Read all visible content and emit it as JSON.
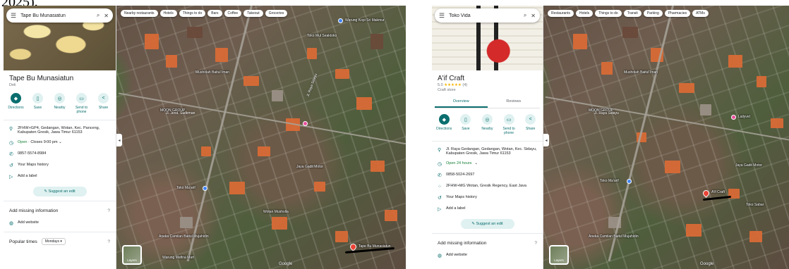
{
  "clip_text": "2025).",
  "left": {
    "search": {
      "query": "Tape Bu Munasiatun"
    },
    "place": {
      "name": "Tape Bu Munasiatun",
      "category": "Deli"
    },
    "actions": [
      {
        "label": "Directions",
        "icon": "directions-icon"
      },
      {
        "label": "Save",
        "icon": "bookmark-icon"
      },
      {
        "label": "Nearby",
        "icon": "nearby-icon"
      },
      {
        "label": "Send to phone",
        "icon": "phone-icon"
      },
      {
        "label": "Share",
        "icon": "share-icon"
      }
    ],
    "info": {
      "address": "2FHW+GP4, Gedangan, Wotan, Kec. Panceng, Kabupaten Gresik, Jawa Timur 61153",
      "hours_status": "Open",
      "hours_detail": " · Closes 9:00 pm",
      "phone": "0857-5574-8984",
      "history": "Your Maps history",
      "label": "Add a label"
    },
    "suggest_edit": "Suggest an edit",
    "missing_info_title": "Add missing information",
    "add_website": "Add website",
    "popular_times": "Popular times",
    "popular_day": "Mondays",
    "chips": [
      "Nearby restaurants",
      "Hotels",
      "Things to do",
      "Bars",
      "Coffee",
      "Takeout",
      "Groceries"
    ],
    "layers": "Layers",
    "map_labels": {
      "poi1": "Toko Mul Seaktoko",
      "poi2": "Warung Kopi Sri Makmur",
      "poi3": "Musholah Baitul Iman",
      "poi4": "MOON GROUP",
      "poi5": "Toko Ma'arif",
      "poi6": "Jaya Gadit Motor",
      "poi7": "Wotan Musholla",
      "poi8": "Aneka Camilan Baitul Mujahidin",
      "poi9": "Tape Bu Munasiatun",
      "poi10": "Warung Mafina Mart",
      "road1": "Jl. Raya Sidayu",
      "road2": "Jl. Jend. Sudirman",
      "brand": "Google"
    }
  },
  "right": {
    "search": {
      "query": "Toko Vida"
    },
    "place": {
      "name": "A'if Craft",
      "rating": "5.0",
      "stars": "★★★★★",
      "reviews": "(4)",
      "category": "Craft store"
    },
    "tabs": [
      "Overview",
      "Reviews"
    ],
    "actions": [
      {
        "label": "Directions",
        "icon": "directions-icon"
      },
      {
        "label": "Save",
        "icon": "bookmark-icon"
      },
      {
        "label": "Nearby",
        "icon": "nearby-icon"
      },
      {
        "label": "Send to phone",
        "icon": "phone-icon"
      },
      {
        "label": "Share",
        "icon": "share-icon"
      }
    ],
    "info": {
      "address": "Jl. Raya Gedangan, Gedangan, Wotan, Kec. Sidayu, Kabupaten Gresik, Jawa Timur 61153",
      "hours_status": "Open 24 hours",
      "phone": "0858-5024-2697",
      "plus_code": "2FHW+MG Wotan, Gresik Regency, East Java",
      "history": "Your Maps history",
      "label": "Add a label"
    },
    "suggest_edit": "Suggest an edit",
    "missing_info_title": "Add missing information",
    "add_website": "Add website",
    "chips": [
      "Restaurants",
      "Hotels",
      "Things to do",
      "Transit",
      "Parking",
      "Pharmacies",
      "ATMs"
    ],
    "layers": "Layers",
    "map_labels": {
      "poi1": "Musholah Baitul Iman",
      "poi2": "MOON GROUP",
      "poi3": "Toko Ma'arif",
      "poi4": "Jaya Gadit Motor",
      "poi5": "A'if Craft",
      "poi6": "Toko Sabar",
      "poi7": "Aneka Camilan Baitul Mujahidin",
      "poi8": "Lailyvet",
      "road1": "Jl. Raya Sidayu",
      "brand": "Google"
    }
  }
}
